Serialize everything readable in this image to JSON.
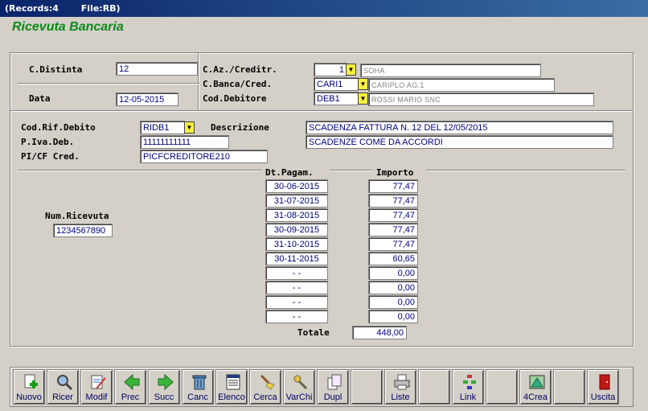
{
  "titlebar": {
    "records": "(Records:4",
    "file": "File:RB)"
  },
  "form_title": "Ricevuta Bancaria",
  "header": {
    "distinta_label": "C.Distinta",
    "distinta_value": "12",
    "data_label": "Data",
    "data_value": "12-05-2015",
    "azienda_label": "C.Az./Creditr.",
    "azienda_code": "1",
    "azienda_name": "SOHA",
    "banca_label": "C.Banca/Cred.",
    "banca_code": "CARI1",
    "banca_name": "CARIPLO AG.1",
    "debitore_label": "Cod.Debitore",
    "debitore_code": "DEB1",
    "debitore_name": "ROSSI MARIO SNC"
  },
  "detail": {
    "rif_label": "Cod.Rif.Debito",
    "rif_value": "RIDB1",
    "descr_label": "Descrizione",
    "descr_value": "SCADENZA FATTURA N. 12 DEL 12/05/2015",
    "piva_label": "P.Iva.Deb.",
    "piva_value": "11111111111",
    "note_value": "SCADENZE COME DA ACCORDI",
    "picf_label": "PI/CF Cred.",
    "picf_value": "PICFCREDITORE210"
  },
  "payments": {
    "dt_header": "Dt.Pagam.",
    "imp_header": "Importo",
    "num_label": "Num.Ricevuta",
    "num_value": "1234567890",
    "rows": [
      {
        "date": "30-06-2015",
        "amount": "77,47"
      },
      {
        "date": "31-07-2015",
        "amount": "77,47"
      },
      {
        "date": "31-08-2015",
        "amount": "77,47"
      },
      {
        "date": "30-09-2015",
        "amount": "77,47"
      },
      {
        "date": "31-10-2015",
        "amount": "77,47"
      },
      {
        "date": "30-11-2015",
        "amount": "60,65"
      },
      {
        "date": "-    -",
        "amount": "0,00"
      },
      {
        "date": "-    -",
        "amount": "0,00"
      },
      {
        "date": "-    -",
        "amount": "0,00"
      },
      {
        "date": "-    -",
        "amount": "0,00"
      }
    ],
    "total_label": "Totale",
    "total_value": "448,00"
  },
  "toolbar": {
    "buttons": [
      {
        "label": "Nuovo",
        "icon": "new-document-icon"
      },
      {
        "label": "Ricer",
        "icon": "magnifier-icon"
      },
      {
        "label": "Modif",
        "icon": "edit-document-icon"
      },
      {
        "label": "Prec",
        "icon": "arrow-left-icon"
      },
      {
        "label": "Succ",
        "icon": "arrow-right-icon"
      },
      {
        "label": "Canc",
        "icon": "trash-icon"
      },
      {
        "label": "Elenco",
        "icon": "list-icon"
      },
      {
        "label": "Cerca",
        "icon": "search-broom-icon"
      },
      {
        "label": "VarChi",
        "icon": "keys-icon"
      },
      {
        "label": "Dupl",
        "icon": "duplicate-icon"
      },
      {
        "label": "",
        "icon": ""
      },
      {
        "label": "Liste",
        "icon": "printer-icon"
      },
      {
        "label": "",
        "icon": ""
      },
      {
        "label": "Link",
        "icon": "network-icon"
      },
      {
        "label": "",
        "icon": ""
      },
      {
        "label": "4Crea",
        "icon": "create-icon"
      },
      {
        "label": "",
        "icon": ""
      },
      {
        "label": "Uscita",
        "icon": "exit-door-icon"
      }
    ]
  },
  "colors": {
    "title_green": "#0a8a1a",
    "field_text": "#000080",
    "dropdown_yellow": "#f8f040"
  }
}
